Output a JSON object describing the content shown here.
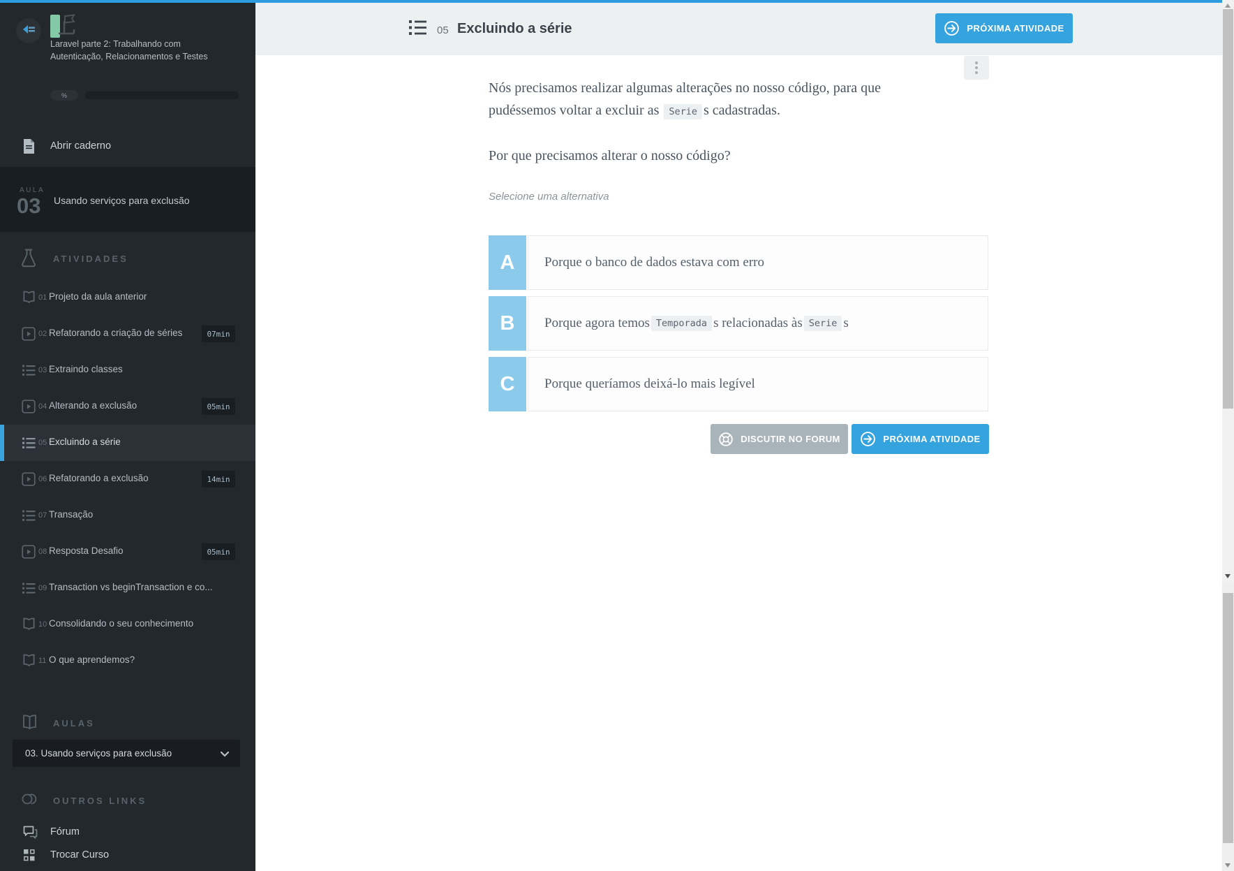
{
  "colors": {
    "accent_blue": "#2e9ce1",
    "button_blue": "#34a3de",
    "button_gray": "#a9b3ba",
    "option_letter_blue": "#8ccaec",
    "sidebar_bg": "#23282c"
  },
  "sidebar": {
    "course_title": "Laravel parte 2: Trabalhando com Autenticação, Relacionamentos e Testes",
    "progress_percent_label": "%",
    "open_notebook_label": "Abrir caderno",
    "current_lesson": {
      "kicker": "AULA",
      "number": "03",
      "title": "Usando serviços para exclusão"
    },
    "activities": {
      "header": "ATIVIDADES",
      "items": [
        {
          "number": "01",
          "label": "Projeto da aula anterior",
          "type": "book"
        },
        {
          "number": "02",
          "label": "Refatorando a criação de séries",
          "duration": "07min",
          "type": "video"
        },
        {
          "number": "03",
          "label": "Extraindo classes",
          "type": "list"
        },
        {
          "number": "04",
          "label": "Alterando a exclusão",
          "duration": "05min",
          "type": "video"
        },
        {
          "number": "05",
          "label": "Excluindo a série",
          "type": "list",
          "active": true
        },
        {
          "number": "06",
          "label": "Refatorando a exclusão",
          "duration": "14min",
          "type": "video"
        },
        {
          "number": "07",
          "label": "Transação",
          "type": "list"
        },
        {
          "number": "08",
          "label": "Resposta Desafio",
          "duration": "05min",
          "type": "video"
        },
        {
          "number": "09",
          "label": "Transaction vs beginTransaction e co...",
          "type": "list"
        },
        {
          "number": "10",
          "label": "Consolidando o seu conhecimento",
          "type": "book"
        },
        {
          "number": "11",
          "label": "O que aprendemos?",
          "type": "book"
        }
      ]
    },
    "lessons": {
      "header": "AULAS",
      "selected": "03. Usando serviços para exclusão"
    },
    "other_links": {
      "header": "OUTROS LINKS",
      "forum_label": "Fórum",
      "switch_course_label": "Trocar Curso"
    }
  },
  "content_header": {
    "activity_number": "05",
    "title": "Excluindo a série",
    "next_button_label": "PRÓXIMA ATIVIDADE"
  },
  "question": {
    "line1": "Nós precisamos realizar algumas alterações no nosso código, para que",
    "line2_pre": "pudéssemos voltar a excluir as ",
    "line2_code": "Serie",
    "line2_post": "s cadastradas.",
    "prompt": "Por que precisamos alterar o nosso código?",
    "hint": "Selecione uma alternativa",
    "options": [
      {
        "letter": "A",
        "text": "Porque o banco de dados estava com erro"
      },
      {
        "letter": "B",
        "pre": "Porque agora temos ",
        "code1": "Temporada",
        "mid": "s relacionadas às ",
        "code2": "Serie",
        "post": "s"
      },
      {
        "letter": "C",
        "text": "Porque queríamos deixá-lo mais legível"
      }
    ],
    "forum_button_label": "DISCUTIR NO FORUM",
    "next_button_label": "PRÓXIMA ATIVIDADE"
  }
}
